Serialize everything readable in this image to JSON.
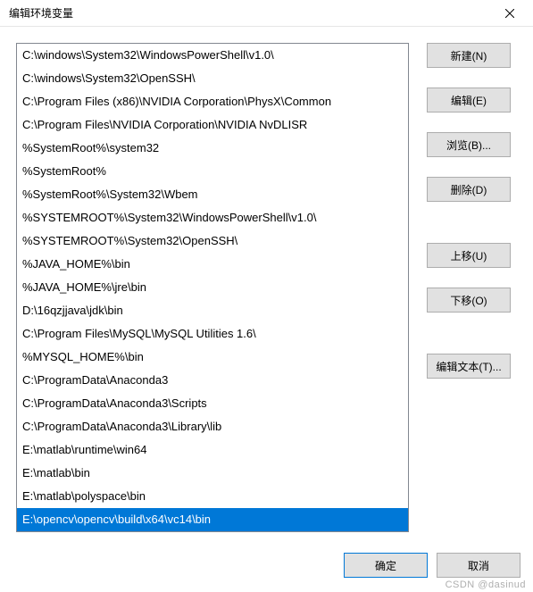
{
  "window": {
    "title": "编辑环境变量"
  },
  "list": {
    "items": [
      "C:\\windows\\System32\\WindowsPowerShell\\v1.0\\",
      "C:\\windows\\System32\\OpenSSH\\",
      "C:\\Program Files (x86)\\NVIDIA Corporation\\PhysX\\Common",
      "C:\\Program Files\\NVIDIA Corporation\\NVIDIA NvDLISR",
      "%SystemRoot%\\system32",
      "%SystemRoot%",
      "%SystemRoot%\\System32\\Wbem",
      "%SYSTEMROOT%\\System32\\WindowsPowerShell\\v1.0\\",
      "%SYSTEMROOT%\\System32\\OpenSSH\\",
      "%JAVA_HOME%\\bin",
      "%JAVA_HOME%\\jre\\bin",
      "D:\\16qzjjava\\jdk\\bin",
      "C:\\Program Files\\MySQL\\MySQL Utilities 1.6\\",
      "%MYSQL_HOME%\\bin",
      "C:\\ProgramData\\Anaconda3",
      "C:\\ProgramData\\Anaconda3\\Scripts",
      "C:\\ProgramData\\Anaconda3\\Library\\lib",
      "E:\\matlab\\runtime\\win64",
      "E:\\matlab\\bin",
      "E:\\matlab\\polyspace\\bin",
      "E:\\opencv\\opencv\\build\\x64\\vc14\\bin"
    ],
    "selected_index": 20
  },
  "buttons": {
    "new": "新建(N)",
    "edit": "编辑(E)",
    "browse": "浏览(B)...",
    "delete": "删除(D)",
    "move_up": "上移(U)",
    "move_down": "下移(O)",
    "edit_text": "编辑文本(T)...",
    "ok": "确定",
    "cancel": "取消"
  },
  "watermark": "CSDN @dasinud"
}
